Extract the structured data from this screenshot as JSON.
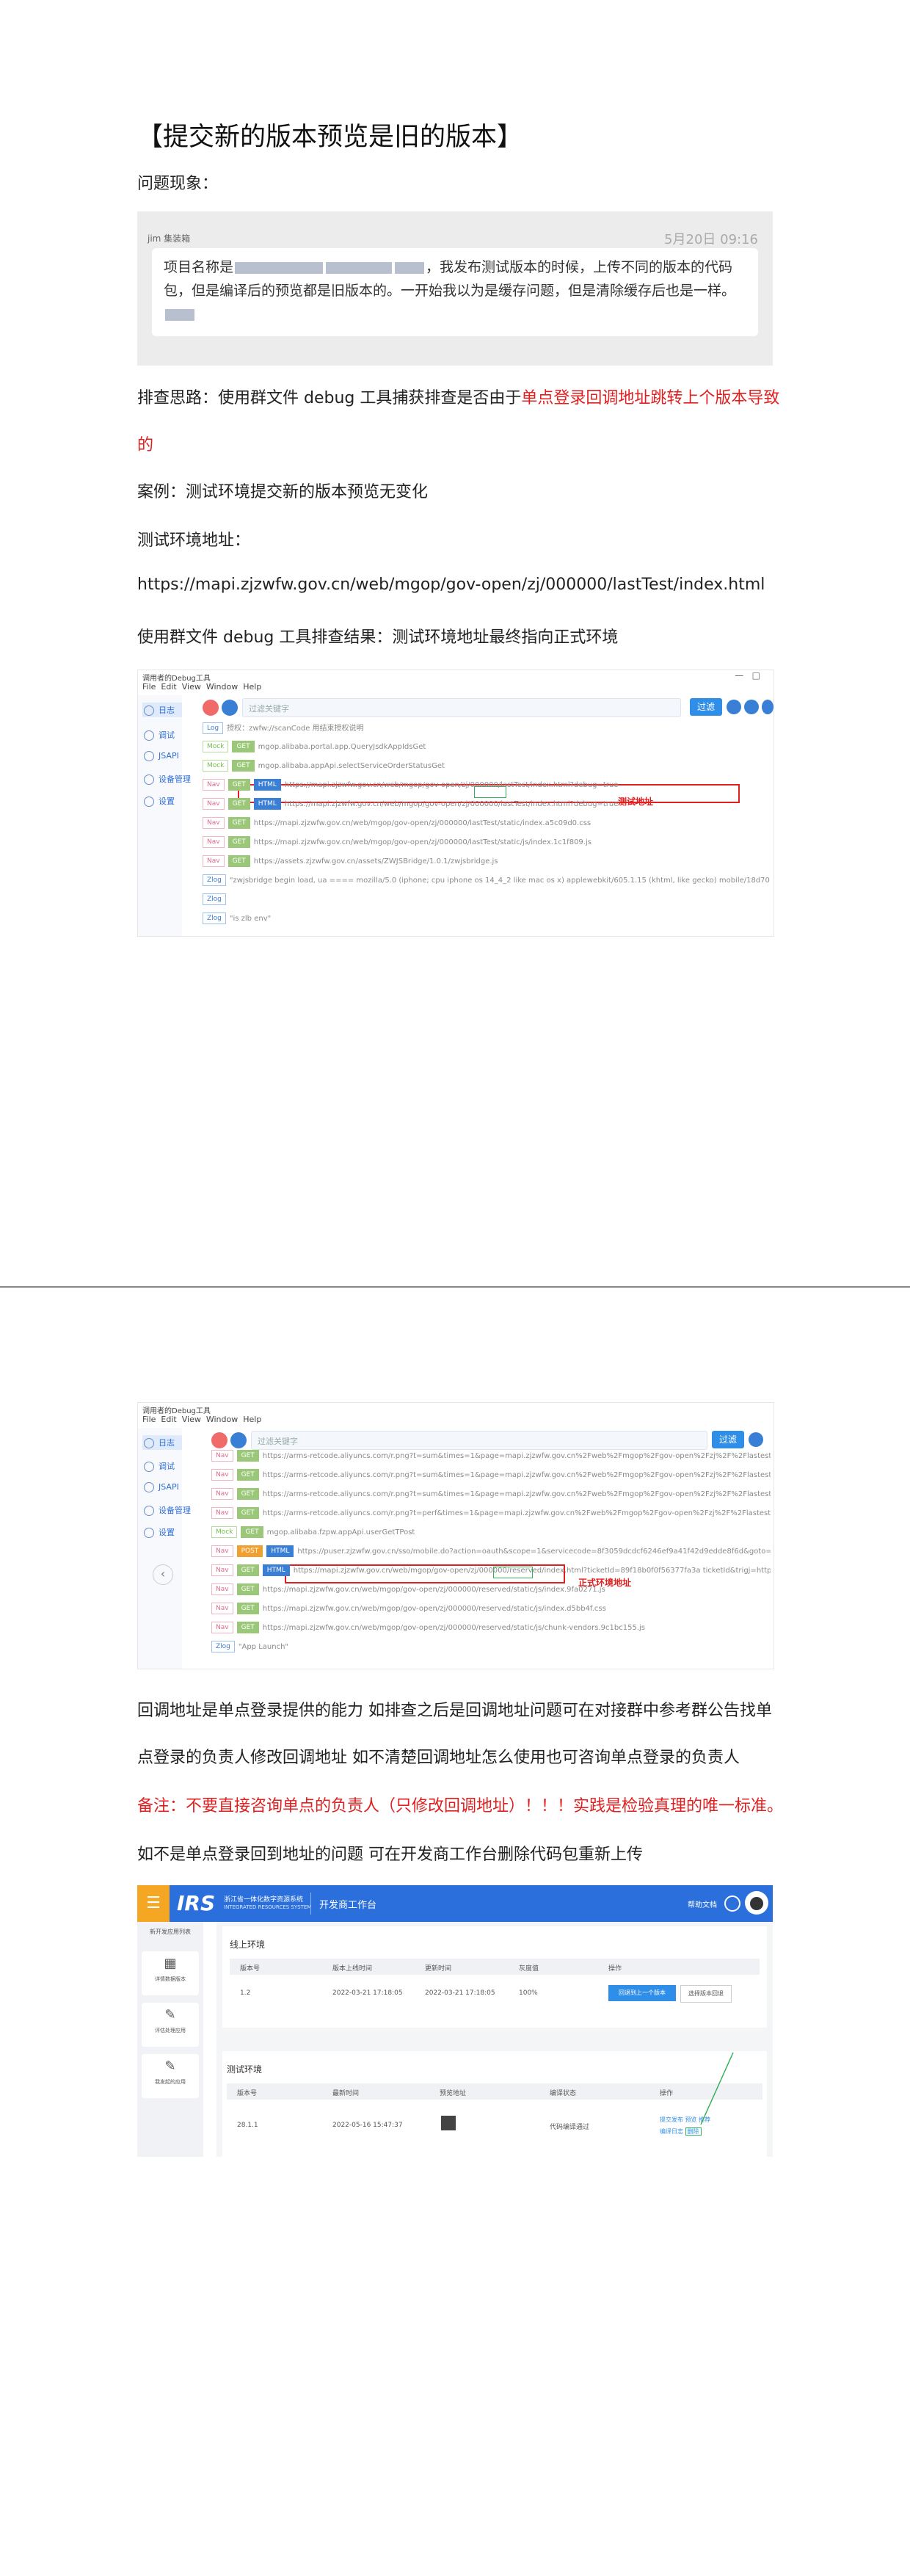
{
  "heading": "【提交新的版本预览是旧的版本】",
  "problem_label": "问题现象：",
  "chat": {
    "name": "jim 集装箱",
    "time": "5月20日 09:16",
    "text_pre": "项目名称是",
    "text_mid": "，我发布测试版本的时候，上传不同的版本的代码包，但是编译后的预览都是旧版本的。一开始我以为是缓存问题，但是清除缓存后也是一样。"
  },
  "para1": {
    "prefix": "排查思路：使用群文件 debug 工具捕获排查是否由于",
    "red": "单点登录回调地址跳转上个版本导致",
    "red_line2": "的"
  },
  "para2": "案例：测试环境提交新的版本预览无变化",
  "para3": "测试环境地址：",
  "para4": "https://mapi.zjzwfw.gov.cn/web/mgop/gov-open/zj/000000/lastTest/index.html",
  "para5": "使用群文件 debug 工具排查结果：测试环境地址最终指向正式环境",
  "shot1": {
    "app_title": "调用者的Debug工具",
    "menu": [
      "File",
      "Edit",
      "View",
      "Window",
      "Help"
    ],
    "search_placeholder": "过滤关键字",
    "filter_btn": "过滤",
    "sidebar": [
      "日志",
      "调试",
      "JSAPI",
      "设备管理",
      "设置"
    ],
    "rows": [
      {
        "tags": [
          "Log"
        ],
        "text": "授权：zwfw://scanCode 用结束授权说明"
      },
      {
        "tags": [
          "Mock",
          "GET"
        ],
        "text": "mgop.alibaba.portal.app.QueryJsdkAppIdsGet"
      },
      {
        "tags": [
          "Mock",
          "GET"
        ],
        "text": "mgop.alibaba.appApi.selectServiceOrderStatusGet"
      },
      {
        "tags": [
          "Nav",
          "GET",
          "HTML"
        ],
        "text": "https://mapi.zjzwfw.gov.cn/web/mgop/gov-open/zj/000000/lastTest/index.html?debug=true"
      },
      {
        "tags": [
          "Nav",
          "GET",
          "HTML"
        ],
        "text": "https://mapi.zjzwfw.gov.cn/web/mgop/gov-open/zj/000000/lastTest/index.html?debug=true"
      },
      {
        "tags": [
          "Nav",
          "GET"
        ],
        "text": "https://mapi.zjzwfw.gov.cn/web/mgop/gov-open/zj/000000/lastTest/static/index.a5c09d0.css"
      },
      {
        "tags": [
          "Nav",
          "GET"
        ],
        "text": "https://mapi.zjzwfw.gov.cn/web/mgop/gov-open/zj/000000/lastTest/static/js/index.1c1f809.js"
      },
      {
        "tags": [
          "Nav",
          "GET"
        ],
        "text": "https://assets.zjzwfw.gov.cn/assets/ZWJSBridge/1.0.1/zwjsbridge.js"
      },
      {
        "tags": [
          "Zlog"
        ],
        "text": "\"zwjsbridge begin load, ua ==== mozilla/5.0 (iphone; cpu iphone os 14_4_2 like mac os x) applewebkit/605.1.15 (khtml, like gecko) mobile/18d70 channelid/3 ariver/1.0.10.ju\""
      },
      {
        "tags": [
          "Zlog"
        ],
        "text": ""
      },
      {
        "tags": [
          "Zlog"
        ],
        "text": "\"is zlb env\""
      }
    ],
    "annotation": "测试地址"
  },
  "shot2": {
    "app_title": "调用者的Debug工具",
    "menu": [
      "File",
      "Edit",
      "View",
      "Window",
      "Help"
    ],
    "search_placeholder": "过滤关键字",
    "filter_btn": "过滤",
    "sidebar": [
      "日志",
      "调试",
      "JSAPI",
      "设备管理",
      "设置"
    ],
    "rows": [
      {
        "tags": [
          "Nav",
          "GET"
        ],
        "text": "https://arms-retcode.aliyuncs.com/r.png?t=sum&times=1&page=mapi.zjzwfw.gov.cn%2Fweb%2Fmgop%2Fgov-open%2Fzj%2F%2Flastest%2Findex.html&tag="
      },
      {
        "tags": [
          "Nav",
          "GET"
        ],
        "text": "https://arms-retcode.aliyuncs.com/r.png?t=sum&times=1&page=mapi.zjzwfw.gov.cn%2Fweb%2Fmgop%2Fgov-open%2Fzj%2F%2Flastest%2Findex.html&tag="
      },
      {
        "tags": [
          "Nav",
          "GET"
        ],
        "text": "https://arms-retcode.aliyuncs.com/r.png?t=sum&times=1&page=mapi.zjzwfw.gov.cn%2Fweb%2Fmgop%2Fgov-open%2Fzj%2F%2Flastest%2Findex.html&tag="
      },
      {
        "tags": [
          "Nav",
          "GET"
        ],
        "text": "https://arms-retcode.aliyuncs.com/r.png?t=perf&times=1&page=mapi.zjzwfw.gov.cn%2Fweb%2Fmgop%2Fgov-open%2Fzj%2F%2Flastest%2Findex.html&tag="
      },
      {
        "tags": [
          "Mock",
          "GET"
        ],
        "text": "mgop.alibaba.fzpw.appApi.userGetTPost"
      },
      {
        "tags": [
          "Nav",
          "POST",
          "HTML"
        ],
        "text": "https://puser.zjzwfw.gov.cn/sso/mobile.do?action=oauth&scope=1&servicecode=8f3059dcdcf6246ef9a41f42d9edde8f6d&goto=https://mapi.zjzwfw.gov.cn"
      },
      {
        "tags": [
          "Nav",
          "GET",
          "HTML"
        ],
        "text": "https://mapi.zjzwfw.gov.cn/web/mgop/gov-open/zj/000000/reserved/index.html?ticketId=89f18b0f0f56377fa3a ticketId&trigj=https"
      },
      {
        "tags": [
          "Nav",
          "GET"
        ],
        "text": "https://mapi.zjzwfw.gov.cn/web/mgop/gov-open/zj/000000/reserved/static/js/index.9fa0271.js"
      },
      {
        "tags": [
          "Nav",
          "GET"
        ],
        "text": "https://mapi.zjzwfw.gov.cn/web/mgop/gov-open/zj/000000/reserved/static/js/index.d5bb4f.css"
      },
      {
        "tags": [
          "Nav",
          "GET"
        ],
        "text": "https://mapi.zjzwfw.gov.cn/web/mgop/gov-open/zj/000000/reserved/static/js/chunk-vendors.9c1bc155.js"
      },
      {
        "tags": [
          "Zlog"
        ],
        "text": "\"App Launch\""
      }
    ],
    "annotation": "正式环境地址"
  },
  "para6": "回调地址是单点登录提供的能力 如排查之后是回调地址问题可在对接群中参考群公告找单",
  "para7": "点登录的负责人修改回调地址 如不清楚回调地址怎么使用也可咨询单点登录的负责人",
  "para8": "备注：不要直接咨询单点的负责人（只修改回调地址）！！！实践是检验真理的唯一标准。",
  "para9": "如不是单点登录回到地址的问题 可在开发商工作台删除代码包重新上传",
  "irs": {
    "logo": "IRS",
    "logo_sub1": "浙江省一体化数字资源系统",
    "logo_sub2": "INTEGRATED RESOURCES SYSTEM",
    "workspace": "开发商工作台",
    "top_right": "帮助文档",
    "side_items": [
      "新开发应用列表",
      "详情数据版本",
      "评估处理应用",
      "我发起的应用"
    ],
    "online": {
      "title": "线上环境",
      "headers": [
        "版本号",
        "版本上线时间",
        "更新时间",
        "灰度值",
        "操作"
      ],
      "row": [
        "1.2",
        "2022-03-21 17:18:05",
        "2022-03-21 17:18:05",
        "100%"
      ],
      "btn_primary": "回退到上一个版本",
      "btn_secondary": "选择版本回退"
    },
    "test": {
      "title": "测试环境",
      "headers": [
        "版本号",
        "最新时间",
        "预览地址",
        "编译状态",
        "操作"
      ],
      "row": [
        "28.1.1",
        "2022-05-16 15:47:37",
        "",
        "代码编译通过"
      ],
      "ops": [
        "提交发布",
        "预览",
        "推荐",
        "编译日志",
        "删除"
      ]
    }
  }
}
